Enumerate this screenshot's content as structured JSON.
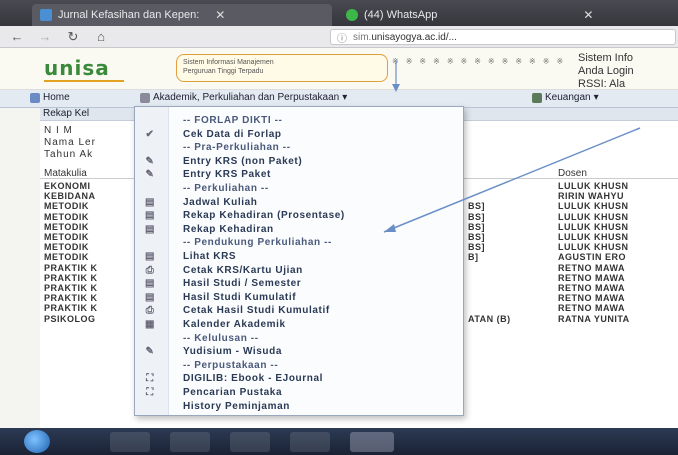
{
  "browser": {
    "tabs": [
      {
        "label": "Jurnal Kefasihan dan Kepen:",
        "active": true
      },
      {
        "label": "(44) WhatsApp",
        "active": false
      }
    ],
    "url_prefix": "sim.",
    "url_host": "unisayogya.ac.id/...",
    "icons": {
      "back": "back-arrow-icon",
      "forward": "forward-arrow-icon",
      "reload": "reload-icon",
      "home": "home-icon"
    }
  },
  "header": {
    "logo": "unisa",
    "system_name": [
      "Sistem Informasi Manajemen",
      "Perguruan Tinggi Terpadu"
    ],
    "info_lines": [
      "Sistem Info",
      "Anda Login",
      "RSSI:   Ala"
    ]
  },
  "menu": {
    "home": "Home",
    "academic": "Akademik, Perkuliahan dan Perpustakaan",
    "finance": "Keuangan"
  },
  "content": {
    "section_title": "Rekap Kel",
    "info_labels": [
      "N I M",
      "Nama Ler",
      "Tahun Ak"
    ],
    "col_matakuliah": "Matakulia",
    "col_dosen": "Dosen",
    "rows": [
      {
        "mk": "EKONOMI",
        "mid": "",
        "dosen": "LULUK KHUSN"
      },
      {
        "mk": "KEBIDANA",
        "mid": "",
        "dosen": "RIRIN WAHYU"
      },
      {
        "mk": "METODIK",
        "mid": "BS]",
        "dosen": "LULUK KHUSN"
      },
      {
        "mk": "METODIK",
        "mid": "BS]",
        "dosen": "LULUK KHUSN"
      },
      {
        "mk": "METODIK",
        "mid": "BS]",
        "dosen": "LULUK KHUSN"
      },
      {
        "mk": "METODIK",
        "mid": "BS]",
        "dosen": "LULUK KHUSN"
      },
      {
        "mk": "METODIK",
        "mid": "BS]",
        "dosen": "LULUK KHUSN"
      },
      {
        "mk": "METODIK",
        "mid": "B]",
        "dosen": "AGUSTIN ERO"
      },
      {
        "mk": "PRAKTIK K",
        "mid": "",
        "dosen": "RETNO MAWA"
      },
      {
        "mk": "PRAKTIK K",
        "mid": "",
        "dosen": "RETNO MAWA"
      },
      {
        "mk": "PRAKTIK K",
        "mid": "",
        "dosen": "RETNO MAWA"
      },
      {
        "mk": "PRAKTIK K",
        "mid": "",
        "dosen": "RETNO MAWA"
      },
      {
        "mk": "PRAKTIK K",
        "mid": "",
        "dosen": "RETNO MAWA"
      },
      {
        "mk": "PSIKOLOG",
        "mid": "ATAN (B)",
        "dosen": "RATNA YUNITA"
      }
    ]
  },
  "dropdown": {
    "items": [
      {
        "label": "-- FORLAP DIKTI --",
        "header": true,
        "icon": ""
      },
      {
        "label": "Cek Data di Forlap",
        "header": false,
        "icon": "check-icon"
      },
      {
        "label": "-- Pra-Perkuliahan --",
        "header": true,
        "icon": ""
      },
      {
        "label": "Entry KRS (non Paket)",
        "header": false,
        "icon": "edit-icon"
      },
      {
        "label": "Entry KRS Paket",
        "header": false,
        "icon": "edit-icon"
      },
      {
        "label": "-- Perkuliahan --",
        "header": true,
        "icon": ""
      },
      {
        "label": "Jadwal Kuliah",
        "header": false,
        "icon": "document-icon"
      },
      {
        "label": "Rekap Kehadiran (Prosentase)",
        "header": false,
        "icon": "document-icon"
      },
      {
        "label": "Rekap Kehadiran",
        "header": false,
        "icon": "document-icon"
      },
      {
        "label": "-- Pendukung Perkuliahan --",
        "header": true,
        "icon": ""
      },
      {
        "label": "Lihat KRS",
        "header": false,
        "icon": "document-icon"
      },
      {
        "label": "Cetak KRS/Kartu Ujian",
        "header": false,
        "icon": "print-icon"
      },
      {
        "label": "Hasil Studi / Semester",
        "header": false,
        "icon": "document-icon"
      },
      {
        "label": "Hasil Studi Kumulatif",
        "header": false,
        "icon": "document-icon"
      },
      {
        "label": "Cetak Hasil Studi Kumulatif",
        "header": false,
        "icon": "print-icon"
      },
      {
        "label": "Kalender Akademik",
        "header": false,
        "icon": "calendar-icon"
      },
      {
        "label": "-- Kelulusan --",
        "header": true,
        "icon": ""
      },
      {
        "label": "Yudisium - Wisuda",
        "header": false,
        "icon": "edit-icon"
      },
      {
        "label": "-- Perpustakaan --",
        "header": true,
        "icon": ""
      },
      {
        "label": "DIGILIB: Ebook - EJournal",
        "header": false,
        "icon": "binoculars-icon"
      },
      {
        "label": "Pencarian Pustaka",
        "header": false,
        "icon": "binoculars-icon"
      },
      {
        "label": "History Peminjaman",
        "header": false,
        "icon": ""
      }
    ]
  },
  "colors": {
    "logo": "#3b8a3b",
    "menu_bg": "#e4eaf2",
    "dropdown_text": "#2a3a55",
    "taskbar": "#1a2334"
  }
}
